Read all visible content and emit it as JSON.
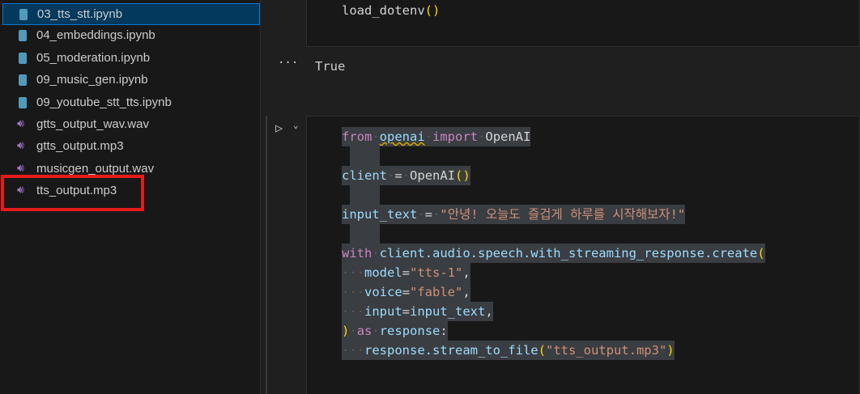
{
  "explorer": {
    "files": [
      {
        "name": "03_tts_stt.ipynb",
        "type": "notebook",
        "selected": true
      },
      {
        "name": "04_embeddings.ipynb",
        "type": "notebook"
      },
      {
        "name": "05_moderation.ipynb",
        "type": "notebook"
      },
      {
        "name": "09_music_gen.ipynb",
        "type": "notebook"
      },
      {
        "name": "09_youtube_stt_tts.ipynb",
        "type": "notebook"
      },
      {
        "name": "gtts_output_wav.wav",
        "type": "audio"
      },
      {
        "name": "gtts_output.mp3",
        "type": "audio"
      },
      {
        "name": "musicgen_output.wav",
        "type": "audio"
      },
      {
        "name": "tts_output.mp3",
        "type": "audio",
        "highlighted": true
      }
    ]
  },
  "cell1": {
    "code": "load_dotenv",
    "parens": "()",
    "output_dots": "···",
    "output": "True"
  },
  "cell2": {
    "run_icon": "▷",
    "chevron": "⌄",
    "lines": [
      [
        [
          "kw",
          "from"
        ],
        [
          "ws",
          "·"
        ],
        [
          "var squig",
          "openai"
        ],
        [
          "ws",
          "·"
        ],
        [
          "kw",
          "import"
        ],
        [
          "ws",
          "·"
        ],
        [
          "cls",
          "OpenAI"
        ]
      ],
      [],
      [
        [
          "var",
          "client"
        ],
        [
          "ws",
          "·"
        ],
        [
          "op",
          "="
        ],
        [
          "ws",
          "·"
        ],
        [
          "cls",
          "OpenAI"
        ],
        [
          "par",
          "()"
        ]
      ],
      [],
      [
        [
          "var",
          "input_text"
        ],
        [
          "ws",
          "·"
        ],
        [
          "op",
          "="
        ],
        [
          "ws",
          "·"
        ],
        [
          "str",
          "\"안녕! 오늘도 즐겁게 하루를 시작해보자!\""
        ]
      ],
      [],
      [
        [
          "kw",
          "with"
        ],
        [
          "ws",
          "·"
        ],
        [
          "var",
          "client.audio.speech.with_streaming_response.create"
        ],
        [
          "par",
          "("
        ]
      ],
      [
        [
          "ws",
          "···"
        ],
        [
          "var",
          "model"
        ],
        [
          "op",
          "="
        ],
        [
          "str",
          "\"tts-1\""
        ],
        [
          "op",
          ","
        ]
      ],
      [
        [
          "ws",
          "···"
        ],
        [
          "var",
          "voice"
        ],
        [
          "op",
          "="
        ],
        [
          "str",
          "\"fable\""
        ],
        [
          "op",
          ","
        ]
      ],
      [
        [
          "ws",
          "···"
        ],
        [
          "var",
          "input"
        ],
        [
          "op",
          "="
        ],
        [
          "var",
          "input_text"
        ],
        [
          "op",
          ","
        ]
      ],
      [
        [
          "par",
          ")"
        ],
        [
          "ws",
          "·"
        ],
        [
          "kw",
          "as"
        ],
        [
          "ws",
          "·"
        ],
        [
          "var",
          "response"
        ],
        [
          "op",
          ":"
        ]
      ],
      [
        [
          "ws",
          "···"
        ],
        [
          "var",
          "response.stream_to_file"
        ],
        [
          "par",
          "("
        ],
        [
          "str",
          "\"tts_output.mp3\""
        ],
        [
          "par",
          ")"
        ]
      ]
    ]
  },
  "colors": {
    "selection": "#04395e",
    "highlight_box": "#e51b1b",
    "audio_icon": "#a074c4",
    "notebook_icon": "#519aba"
  }
}
